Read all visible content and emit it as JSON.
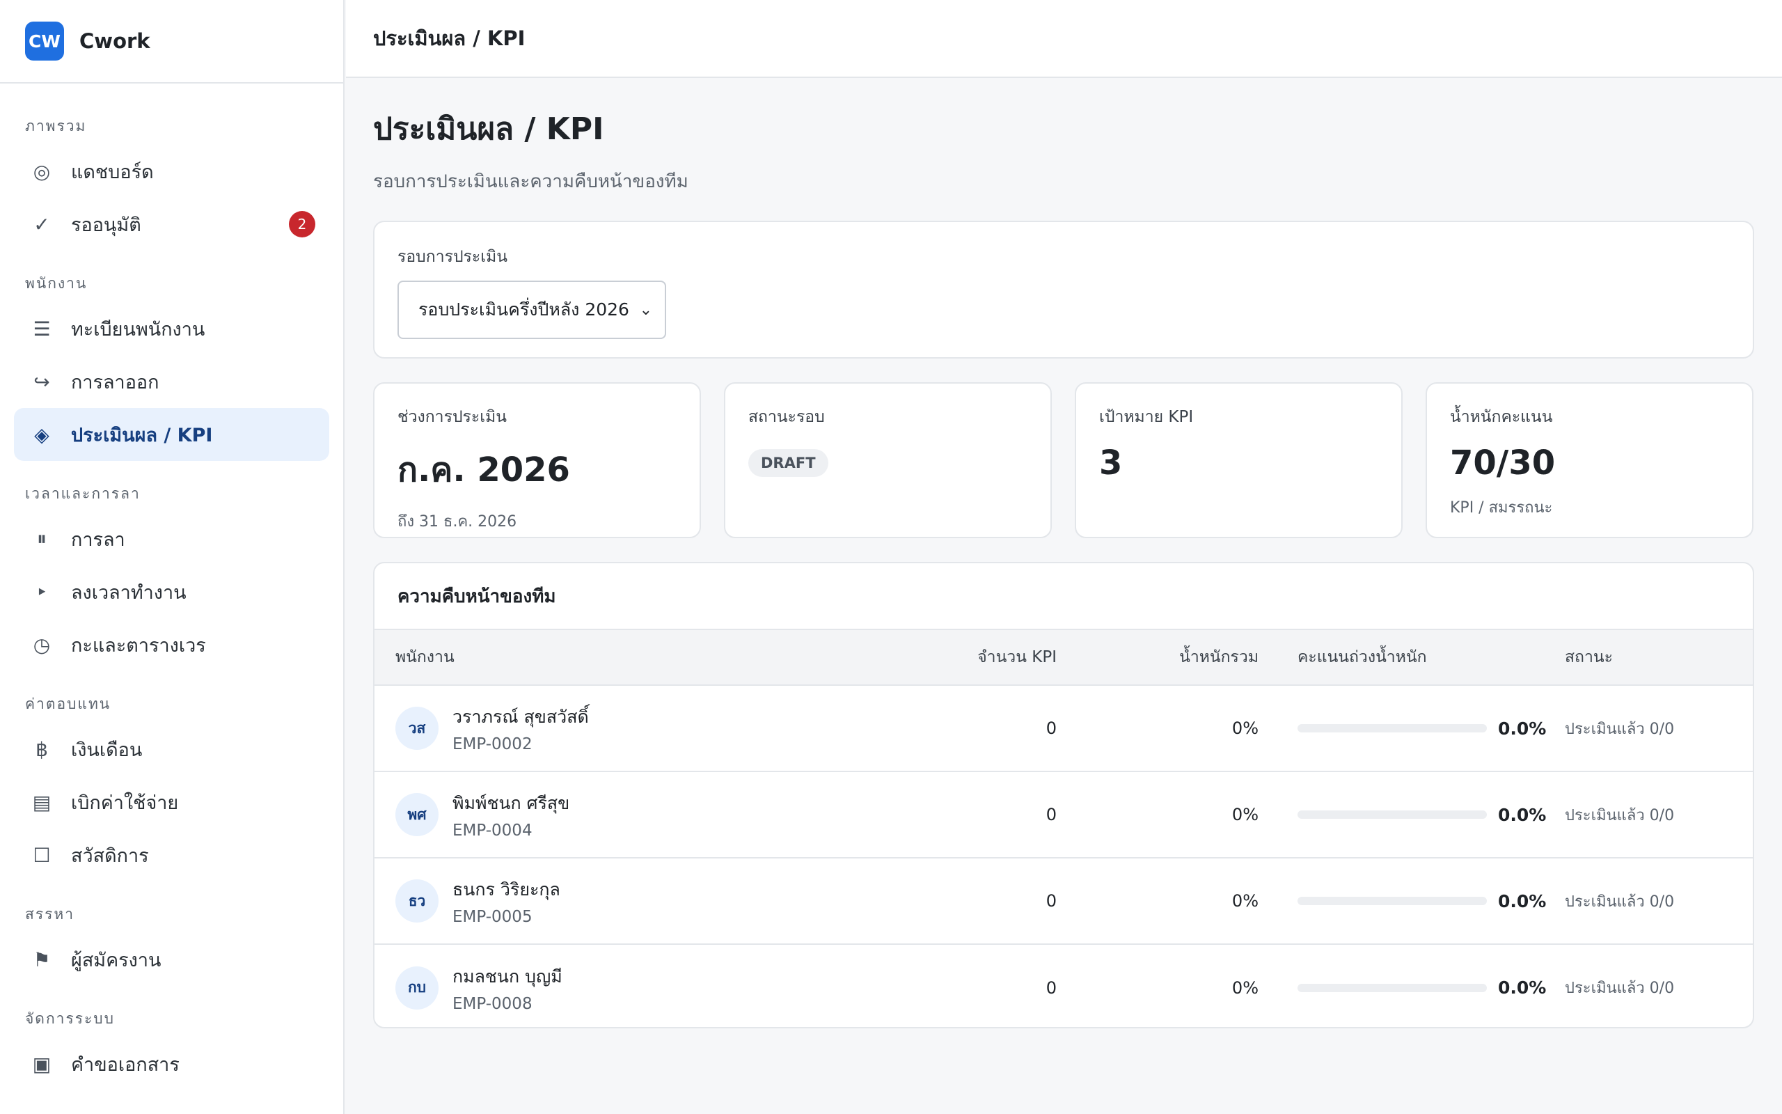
{
  "brand": {
    "logo_text": "CW",
    "name": "Cwork"
  },
  "sidebar": {
    "sections": [
      {
        "title": "ภาพรวม",
        "items": [
          {
            "icon": "◎",
            "icon_name": "dashboard-icon",
            "label": "แดชบอร์ด"
          },
          {
            "icon": "✓",
            "icon_name": "check-icon",
            "label": "รออนุมัติ",
            "badge": "2"
          }
        ]
      },
      {
        "title": "พนักงาน",
        "items": [
          {
            "icon": "☰",
            "icon_name": "list-icon",
            "label": "ทะเบียนพนักงาน"
          },
          {
            "icon": "↪",
            "icon_name": "exit-icon",
            "label": "การลาออก"
          },
          {
            "icon": "◈",
            "icon_name": "diamond-icon",
            "label": "ประเมินผล / KPI",
            "active": true
          }
        ]
      },
      {
        "title": "เวลาและการลา",
        "items": [
          {
            "icon": "⏸",
            "icon_name": "pause-icon",
            "label": "การลา"
          },
          {
            "icon": "‣",
            "icon_name": "bullet-icon",
            "label": "ลงเวลาทำงาน"
          },
          {
            "icon": "◷",
            "icon_name": "clock-icon",
            "label": "กะและตารางเวร"
          }
        ]
      },
      {
        "title": "ค่าตอบแทน",
        "items": [
          {
            "icon": "฿",
            "icon_name": "baht-icon",
            "label": "เงินเดือน"
          },
          {
            "icon": "▤",
            "icon_name": "receipt-icon",
            "label": "เบิกค่าใช้จ่าย"
          },
          {
            "icon": "☐",
            "icon_name": "box-icon",
            "label": "สวัสดิการ"
          }
        ]
      },
      {
        "title": "สรรหา",
        "items": [
          {
            "icon": "⚑",
            "icon_name": "flag-icon",
            "label": "ผู้สมัครงาน"
          }
        ]
      },
      {
        "title": "จัดการระบบ",
        "items": [
          {
            "icon": "▣",
            "icon_name": "document-icon",
            "label": "คำขอเอกสาร"
          }
        ]
      }
    ]
  },
  "topbar": {
    "title": "ประเมินผล / KPI"
  },
  "page": {
    "title": "ประเมินผล / KPI",
    "subtitle": "รอบการประเมินและความคืบหน้าของทีม"
  },
  "round": {
    "label": "รอบการประเมิน",
    "selected": "รอบประเมินครึ่งปีหลัง 2026"
  },
  "stats": {
    "period": {
      "label": "ช่วงการประเมิน",
      "value": "ก.ค. 2026",
      "sub": "ถึง 31 ธ.ค. 2026"
    },
    "status": {
      "label": "สถานะรอบ",
      "pill": "DRAFT"
    },
    "kpi_target": {
      "label": "เป้าหมาย KPI",
      "value": "3"
    },
    "weight": {
      "label": "น้ำหนักคะแนน",
      "value": "70/30",
      "sub": "KPI / สมรรถนะ"
    }
  },
  "team": {
    "title": "ความคืบหน้าของทีม",
    "columns": {
      "employee": "พนักงาน",
      "kpi_count": "จำนวน KPI",
      "total_weight": "น้ำหนักรวม",
      "weighted_score": "คะแนนถ่วงน้ำหนัก",
      "status": "สถานะ"
    },
    "rows": [
      {
        "initials": "วส",
        "name": "วราภรณ์ สุขสวัสดิ์",
        "code": "EMP-0002",
        "kpi_count": "0",
        "total_weight": "0%",
        "score": "0.0%",
        "score_fraction": 0,
        "status": "ประเมินแล้ว 0/0"
      },
      {
        "initials": "พศ",
        "name": "พิมพ์ชนก ศรีสุข",
        "code": "EMP-0004",
        "kpi_count": "0",
        "total_weight": "0%",
        "score": "0.0%",
        "score_fraction": 0,
        "status": "ประเมินแล้ว 0/0"
      },
      {
        "initials": "ธว",
        "name": "ธนกร วิริยะกุล",
        "code": "EMP-0005",
        "kpi_count": "0",
        "total_weight": "0%",
        "score": "0.0%",
        "score_fraction": 0,
        "status": "ประเมินแล้ว 0/0"
      },
      {
        "initials": "กบ",
        "name": "กมลชนก บุญมี",
        "code": "EMP-0008",
        "kpi_count": "0",
        "total_weight": "0%",
        "score": "0.0%",
        "score_fraction": 0,
        "status": "ประเมินแล้ว 0/0"
      }
    ]
  }
}
